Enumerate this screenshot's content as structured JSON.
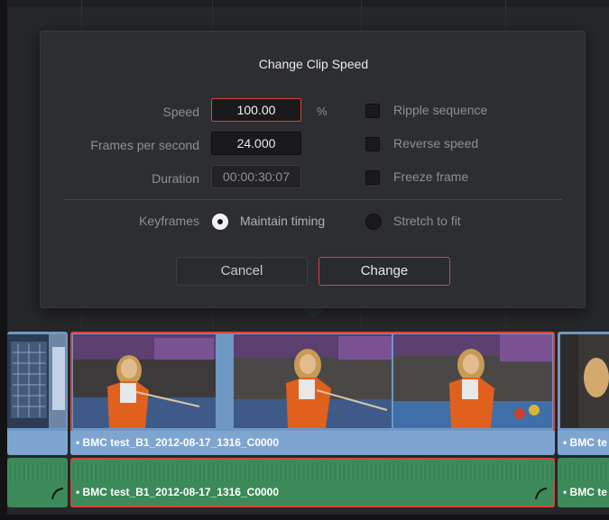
{
  "dialog": {
    "title": "Change Clip Speed",
    "speed": {
      "label": "Speed",
      "value": "100.00",
      "unit": "%"
    },
    "fps": {
      "label": "Frames per second",
      "value": "24.000"
    },
    "duration": {
      "label": "Duration",
      "value": "00:00:30:07"
    },
    "checkboxes": [
      {
        "label": "Ripple sequence",
        "checked": false
      },
      {
        "label": "Reverse speed",
        "checked": false
      },
      {
        "label": "Freeze frame",
        "checked": false
      }
    ],
    "keyframes": {
      "label": "Keyframes",
      "options": [
        {
          "label": "Maintain timing",
          "selected": true
        },
        {
          "label": "Stretch to fit",
          "selected": false
        }
      ]
    },
    "buttons": {
      "cancel": "Cancel",
      "change": "Change"
    }
  },
  "timeline": {
    "video_clips": [
      {
        "name": ""
      },
      {
        "name": "• BMC test_B1_2012-08-17_1316_C0000",
        "selected": true
      },
      {
        "name": "• BMC te"
      }
    ],
    "audio_clips": [
      {
        "name": ""
      },
      {
        "name": "• BMC test_B1_2012-08-17_1316_C0000",
        "selected": true
      },
      {
        "name": "• BMC te"
      }
    ]
  },
  "colors": {
    "accent": "#d4463a",
    "video_clip": "#6e97c4",
    "audio_clip": "#3c8a5a",
    "dialog_bg": "#2d2e31"
  }
}
